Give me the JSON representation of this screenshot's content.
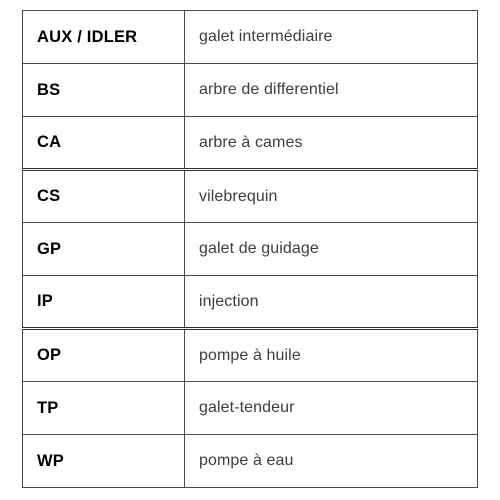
{
  "document": {
    "type": "abbreviation-glossary-table",
    "language": "fr",
    "background_color": "#ffffff",
    "border_color": "#4a4a4a",
    "abbr_text_color": "#000000",
    "term_text_color": "#3d3d3d"
  },
  "table": {
    "columns": [
      {
        "key": "abbr",
        "header": ""
      },
      {
        "key": "term",
        "header": ""
      }
    ],
    "rows": [
      {
        "abbr": "AUX / IDLER",
        "term": "galet intermédiaire",
        "group_start": false
      },
      {
        "abbr": "BS",
        "term": "arbre de differentiel",
        "group_start": false
      },
      {
        "abbr": "CA",
        "term": "arbre à cames",
        "group_start": false
      },
      {
        "abbr": "CS",
        "term": "vilebrequin",
        "group_start": true
      },
      {
        "abbr": "GP",
        "term": "galet de guidage",
        "group_start": false
      },
      {
        "abbr": "IP",
        "term": "injection",
        "group_start": false
      },
      {
        "abbr": "OP",
        "term": "pompe à huile",
        "group_start": true
      },
      {
        "abbr": "TP",
        "term": "galet-tendeur",
        "group_start": false
      },
      {
        "abbr": "WP",
        "term": "pompe à eau",
        "group_start": false
      }
    ]
  }
}
